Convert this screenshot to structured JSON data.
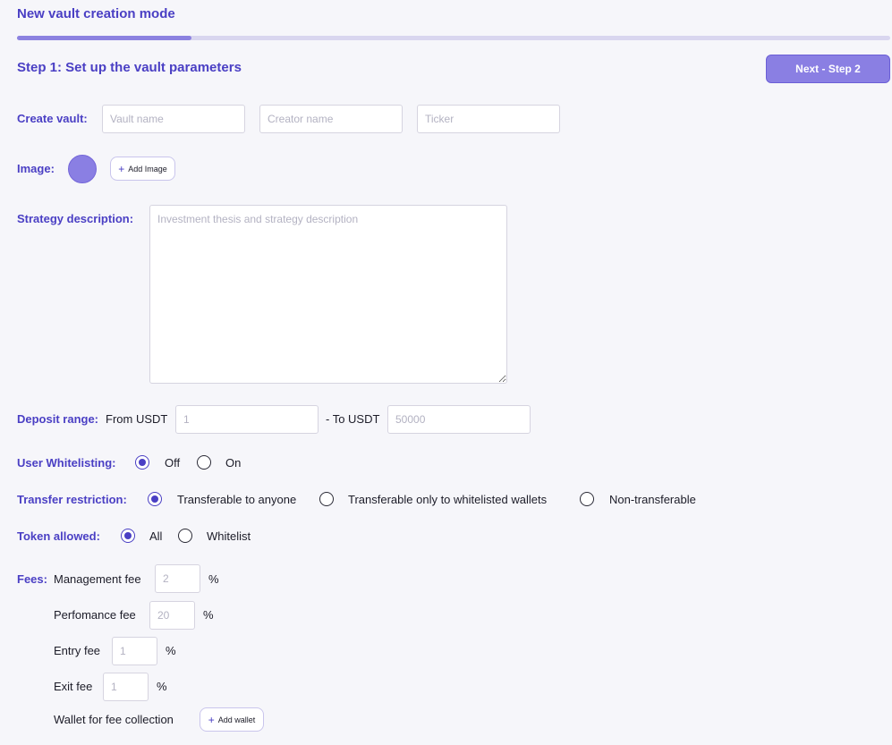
{
  "header": {
    "title": "New vault creation mode",
    "progress": 0.2
  },
  "step": {
    "title": "Step 1: Set up the vault parameters",
    "next_label": "Next - Step 2"
  },
  "create_vault": {
    "label": "Create vault:",
    "vault_name_placeholder": "Vault name",
    "creator_name_placeholder": "Creator name",
    "ticker_placeholder": "Ticker"
  },
  "image": {
    "label": "Image:",
    "add_label": "Add Image"
  },
  "strategy": {
    "label": "Strategy description:",
    "placeholder": "Investment thesis and strategy description"
  },
  "deposit": {
    "label": "Deposit range:",
    "from_label": "From USDT",
    "from_placeholder": "1",
    "to_label": "- To USDT",
    "to_placeholder": "50000"
  },
  "whitelisting": {
    "label": "User Whitelisting:",
    "options": [
      "Off",
      "On"
    ],
    "selected": "Off"
  },
  "transfer": {
    "label": "Transfer restriction:",
    "options": [
      "Transferable to anyone",
      "Transferable only to whitelisted wallets",
      "Non-transferable"
    ],
    "selected": "Transferable to anyone"
  },
  "token": {
    "label": "Token allowed:",
    "options": [
      "All",
      "Whitelist"
    ],
    "selected": "All"
  },
  "fees": {
    "label": "Fees:",
    "percent": "%",
    "management": {
      "label": "Management fee",
      "placeholder": "2"
    },
    "performance": {
      "label": "Perfomance fee",
      "placeholder": "20"
    },
    "entry": {
      "label": "Entry fee",
      "placeholder": "1"
    },
    "exit": {
      "label": "Exit fee",
      "placeholder": "1"
    },
    "wallet": {
      "label": "Wallet for fee collection",
      "add_label": "Add wallet"
    }
  },
  "colors": {
    "accent": "#4a3fc4",
    "button": "#8a7fe3",
    "background": "#f6f6fa"
  }
}
